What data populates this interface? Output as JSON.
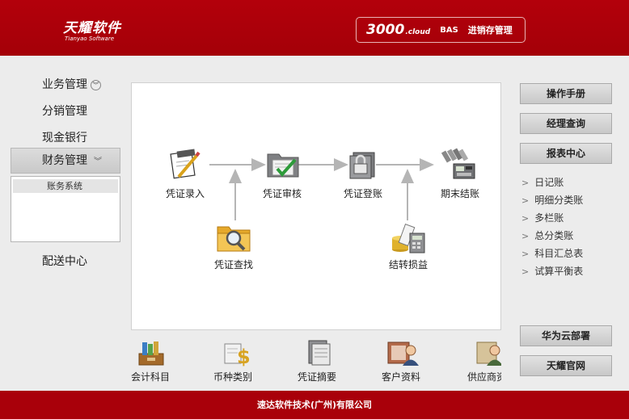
{
  "header": {
    "logo_cn": "天耀软件",
    "logo_en": "Tianyao Software",
    "product_number": "3000",
    "product_cloud": ".cloud",
    "product_bas": "BAS",
    "product_name": "进销存管理"
  },
  "nav": {
    "items": [
      {
        "label": "业务管理"
      },
      {
        "label": "分销管理"
      },
      {
        "label": "现金银行"
      },
      {
        "label": "财务管理"
      },
      {
        "label": "配送中心"
      }
    ],
    "sub_items": [
      {
        "label": "账务系统"
      }
    ]
  },
  "flow": {
    "nodes": [
      {
        "label": "凭证录入",
        "icon": "voucher-entry-icon"
      },
      {
        "label": "凭证审核",
        "icon": "voucher-audit-icon"
      },
      {
        "label": "凭证登账",
        "icon": "voucher-posting-icon"
      },
      {
        "label": "期末结账",
        "icon": "period-closing-icon"
      },
      {
        "label": "凭证查找",
        "icon": "voucher-search-icon"
      },
      {
        "label": "结转损益",
        "icon": "profit-loss-transfer-icon"
      }
    ]
  },
  "shortcuts": [
    {
      "label": "会计科目",
      "icon": "accounting-subjects-icon"
    },
    {
      "label": "币种类别",
      "icon": "currency-types-icon"
    },
    {
      "label": "凭证摘要",
      "icon": "voucher-summary-icon"
    },
    {
      "label": "客户资料",
      "icon": "customer-info-icon"
    },
    {
      "label": "供应商资料",
      "icon": "supplier-info-icon"
    }
  ],
  "right": {
    "buttons_top": [
      {
        "label": "操作手册"
      },
      {
        "label": "经理查询"
      },
      {
        "label": "报表中心"
      }
    ],
    "reports": [
      {
        "label": "日记账"
      },
      {
        "label": "明细分类账"
      },
      {
        "label": "多栏账"
      },
      {
        "label": "总分类账"
      },
      {
        "label": "科目汇总表"
      },
      {
        "label": "试算平衡表"
      }
    ],
    "buttons_bottom": [
      {
        "label": "华为云部署"
      },
      {
        "label": "天耀官网"
      }
    ]
  },
  "footer": {
    "text": "速达软件技术(广州)有限公司"
  },
  "colors": {
    "brand_red": "#a9000a",
    "arrow_gray": "#b5b5b5"
  }
}
